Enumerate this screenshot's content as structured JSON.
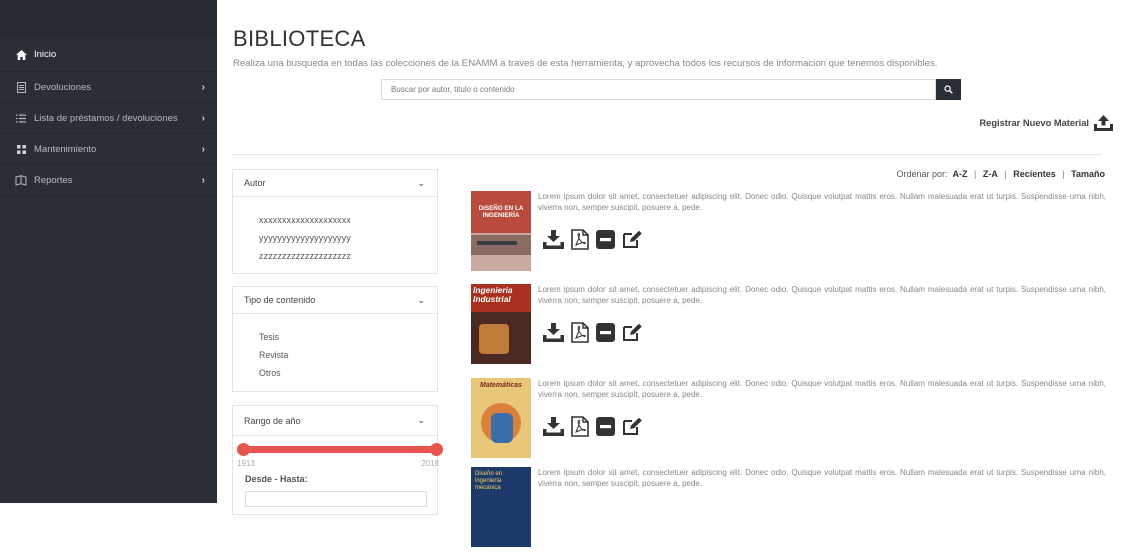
{
  "sidebar": {
    "items": [
      {
        "label": "Inicio",
        "icon": "home-icon"
      },
      {
        "label": "Devoluciones",
        "icon": "file-icon"
      },
      {
        "label": "Lista de préstamos / devoluciones",
        "icon": "list-icon"
      },
      {
        "label": "Mantenimiento",
        "icon": "grid-icon"
      },
      {
        "label": "Reportes",
        "icon": "reports-icon"
      }
    ]
  },
  "header": {
    "title": "BIBLIOTECA",
    "subtitle": "Realiza una busqueda en todas las colecciones de la ENAMM a traves de esta herramienta, y aprovecha todos los recursos de informacion que tenemos disponibles."
  },
  "search": {
    "placeholder": "Buscar por autor, titulo o contenido"
  },
  "register": {
    "label": "Registrar Nuevo Material"
  },
  "filters": {
    "autor": {
      "title": "Autor",
      "options": [
        "xxxxxxxxxxxxxxxxxxxx",
        "yyyyyyyyyyyyyyyyyyyy",
        "zzzzzzzzzzzzzzzzzzzz"
      ]
    },
    "tipo": {
      "title": "Tipo de contenido",
      "options": [
        "Tesis",
        "Revista",
        "Otros"
      ]
    },
    "rango": {
      "title": "Rango de año",
      "min_year": "1913",
      "max_year": "2018",
      "label": "Desde - Hasta:"
    }
  },
  "sort": {
    "label": "Ordenar por:",
    "options": [
      "A-Z",
      "Z-A",
      "Recientes",
      "Tamaño"
    ]
  },
  "results": [
    {
      "cover_title": "DISEÑO EN LA INGENIERÍA",
      "cover_color": "#b84a3e",
      "description": "Lorem ipsum dolor sit amet, consectetuer adipiscing elit. Donec odio. Quisque volutpat mattis eros. Nullam malesuada erat ut turpis. Suspendisse urna nibh, viverra non, semper suscipit, posuere a, pede."
    },
    {
      "cover_title": "Ingenieria Industrial",
      "cover_color": "#a8321f",
      "description": "Lorem ipsum dolor sit amet, consectetuer adipiscing elit. Donec odio. Quisque volutpat mattis eros. Nullam malesuada erat ut turpis. Suspendisse urna nibh, viverra non, semper suscipit, posuere a, pede."
    },
    {
      "cover_title": "Matemáticas",
      "cover_color": "#d9a43a",
      "description": "Lorem ipsum dolor sit amet, consectetuer adipiscing elit. Donec odio. Quisque volutpat mattis eros. Nullam malesuada erat ut turpis. Suspendisse urna nibh, viverra non, semper suscipit, posuere a, pede."
    },
    {
      "cover_title": "Diseño en ingeniería mecánica",
      "cover_color": "#1e3a6b",
      "description": "Lorem ipsum dolor sit amet, consectetuer adipiscing elit. Donec odio. Quisque volutpat mattis eros. Nullam malesuada erat ut turpis. Suspendisse urna nibh, viverra non, semper suscipit, posuere a, pede."
    }
  ],
  "colors": {
    "sidebar_bg": "#2a2f37",
    "slider": "#e8544f"
  }
}
